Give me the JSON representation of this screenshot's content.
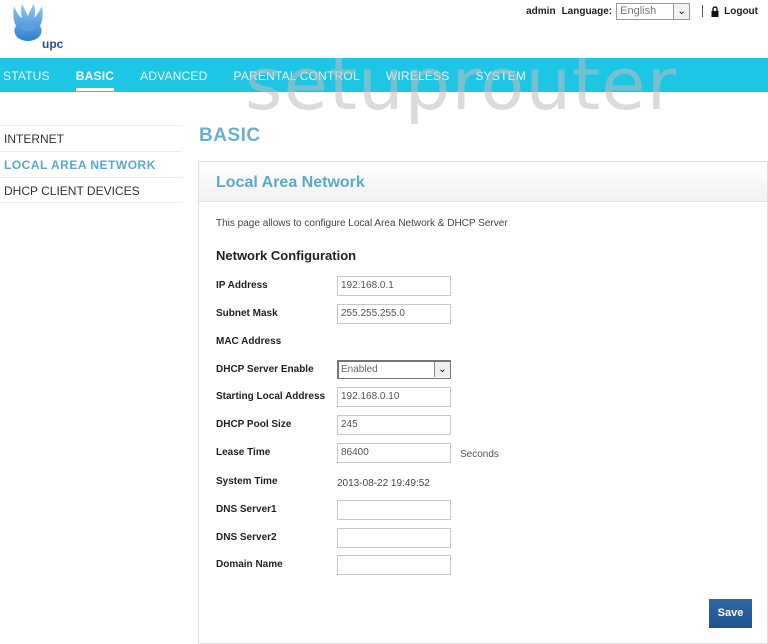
{
  "brand": {
    "logo_text": "upc"
  },
  "usermenu": {
    "user": "admin",
    "language_label": "Language:",
    "language_value": "English",
    "logout_label": "Logout"
  },
  "nav": {
    "items": [
      {
        "label": "STATUS",
        "active": false
      },
      {
        "label": "BASIC",
        "active": true
      },
      {
        "label": "ADVANCED",
        "active": false
      },
      {
        "label": "PARENTAL CONTROL",
        "active": false
      },
      {
        "label": "WIRELESS",
        "active": false
      },
      {
        "label": "SYSTEM",
        "active": false
      }
    ]
  },
  "watermark": "setuprouter",
  "sidebar": {
    "items": [
      {
        "label": "INTERNET",
        "active": false
      },
      {
        "label": "LOCAL AREA NETWORK",
        "active": true
      },
      {
        "label": "DHCP CLIENT DEVICES",
        "active": false
      }
    ]
  },
  "page": {
    "title": "BASIC",
    "panel_title": "Local Area Network",
    "description": "This page allows to configure Local Area Network & DHCP Server",
    "section_title": "Network Configuration",
    "save_label": "Save"
  },
  "form": {
    "ip_address": {
      "label": "IP Address",
      "value": "192.168.0.1"
    },
    "subnet_mask": {
      "label": "Subnet Mask",
      "value": "255.255.255.0"
    },
    "mac_address": {
      "label": "MAC Address",
      "value": ""
    },
    "dhcp_server_enable": {
      "label": "DHCP Server Enable",
      "value": "Enabled"
    },
    "starting_local_address": {
      "label": "Starting Local Address",
      "value": "192.168.0.10"
    },
    "dhcp_pool_size": {
      "label": "DHCP Pool Size",
      "value": "245"
    },
    "lease_time": {
      "label": "Lease Time",
      "value": "86400",
      "unit": "Seconds"
    },
    "system_time": {
      "label": "System Time",
      "value": "2013-08-22 19:49:52"
    },
    "dns_server1": {
      "label": "DNS Server1",
      "value": ""
    },
    "dns_server2": {
      "label": "DNS Server2",
      "value": ""
    },
    "domain_name": {
      "label": "Domain Name",
      "value": ""
    }
  },
  "colors": {
    "nav_bg": "#1ec6e6",
    "accent_title": "#5da9cc",
    "save_button": "#1f5390"
  }
}
